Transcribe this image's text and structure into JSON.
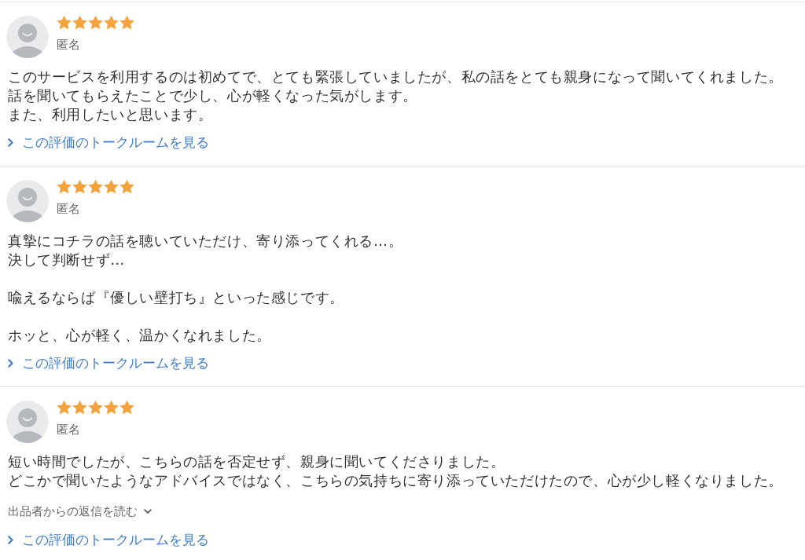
{
  "reviews": [
    {
      "reviewer": "匿名",
      "stars": 5,
      "paragraphs": [
        [
          "このサービスを利用するのは初めてで、とても緊張していましたが、私の話をとても親身になって聞いてくれました。",
          "話を聞いてもらえたことで少し、心が軽くなった気がします。",
          "また、利用したいと思います。"
        ]
      ],
      "talkroom_link": "この評価のトークルームを見る"
    },
    {
      "reviewer": "匿名",
      "stars": 5,
      "paragraphs": [
        [
          "真摯にコチラの話を聴いていただけ、寄り添ってくれる…。",
          "決して判断せず…"
        ],
        [
          "喩えるならば『優しい壁打ち』といった感じです。"
        ],
        [
          "ホッと、心が軽く、温かくなれました。"
        ]
      ],
      "talkroom_link": "この評価のトークルームを見る"
    },
    {
      "reviewer": "匿名",
      "stars": 5,
      "paragraphs": [
        [
          "短い時間でしたが、こちらの話を否定せず、親身に聞いてくださりました。",
          "どこかで聞いたようなアドバイスではなく、こちらの気持ちに寄り添っていただけたので、心が少し軽くなりました。"
        ]
      ],
      "reply_toggle": "出品者からの返信を読む",
      "talkroom_link": "この評価のトークルームを見る"
    }
  ]
}
